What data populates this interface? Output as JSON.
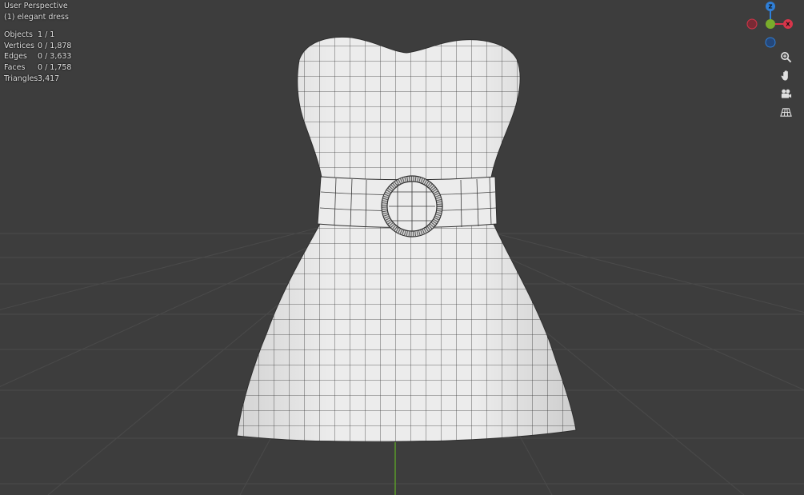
{
  "viewport": {
    "mode": "User Perspective",
    "object_label": "(1) elegant dress",
    "background_color": "#3d3d3d",
    "grid_color": "#4a4a4a",
    "y_axis_color": "#5a9a2a"
  },
  "stats": [
    {
      "label": "Objects",
      "value": "1 / 1"
    },
    {
      "label": "Vertices",
      "value": "0 / 1,878"
    },
    {
      "label": "Edges",
      "value": "0 / 3,633"
    },
    {
      "label": "Faces",
      "value": "0 / 1,758"
    },
    {
      "label": "Triangles",
      "value": "3,417"
    }
  ],
  "gizmo": {
    "z_label": "Z",
    "x_label": "X",
    "z_color": "#2f7fd8",
    "x_color": "#d8354a",
    "y_color": "#79ac2b"
  },
  "nav_buttons": [
    {
      "name": "zoom-button",
      "icon": "zoom-icon"
    },
    {
      "name": "pan-button",
      "icon": "hand-icon"
    },
    {
      "name": "camera-view-button",
      "icon": "camera-icon"
    },
    {
      "name": "ortho-toggle-button",
      "icon": "grid-icon"
    }
  ]
}
